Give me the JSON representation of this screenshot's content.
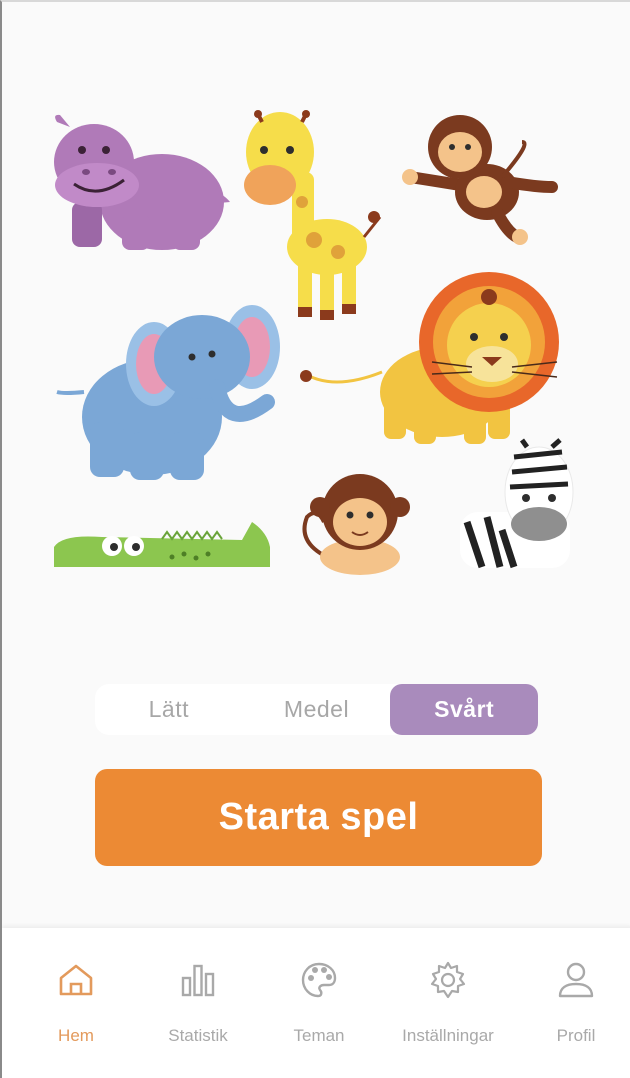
{
  "animals": [
    {
      "name": "hippo"
    },
    {
      "name": "giraffe"
    },
    {
      "name": "monkey-hanging"
    },
    {
      "name": "elephant"
    },
    {
      "name": "lion"
    },
    {
      "name": "crocodile"
    },
    {
      "name": "monkey-sitting"
    },
    {
      "name": "zebra"
    }
  ],
  "difficulty": {
    "options": [
      {
        "label": "Lätt"
      },
      {
        "label": "Medel"
      },
      {
        "label": "Svårt"
      }
    ],
    "selected": "Svårt",
    "active_color": "#a98bbc"
  },
  "start_button": {
    "label": "Starta spel",
    "color": "#ec8a34"
  },
  "tabbar": {
    "items": [
      {
        "label": "Hem",
        "icon": "home-icon",
        "active": true
      },
      {
        "label": "Statistik",
        "icon": "bar-chart-icon",
        "active": false
      },
      {
        "label": "Teman",
        "icon": "palette-icon",
        "active": false
      },
      {
        "label": "Inställningar",
        "icon": "gear-icon",
        "active": false
      },
      {
        "label": "Profil",
        "icon": "user-icon",
        "active": false
      }
    ],
    "active_color": "#e39a5c",
    "inactive_color": "#a9a9a9"
  }
}
